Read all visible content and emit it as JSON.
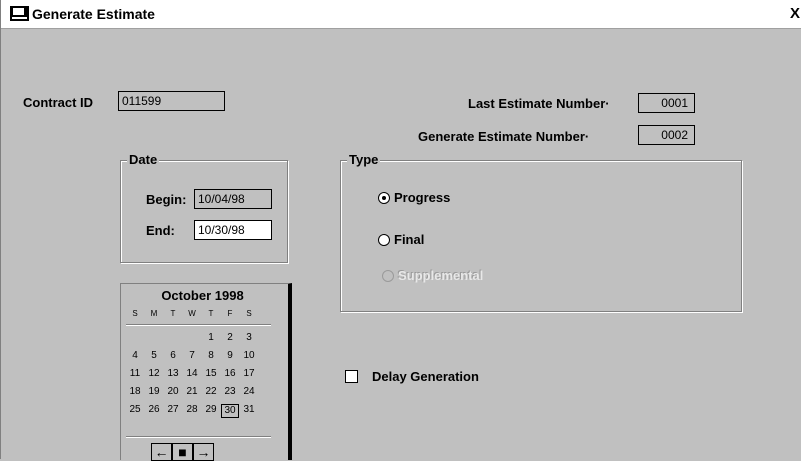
{
  "window": {
    "title": "Generate Estimate",
    "close_label": "X"
  },
  "contract": {
    "label": "Contract ID",
    "value": "011599"
  },
  "last_estimate": {
    "label": "Last Estimate Number·",
    "value": "0001"
  },
  "generate_estimate": {
    "label": "Generate Estimate Number·",
    "value": "0002"
  },
  "date_group": {
    "legend": "Date",
    "begin_label": "Begin:",
    "begin_value": "10/04/98",
    "end_label": "End:",
    "end_value": "10/30/98"
  },
  "type_group": {
    "legend": "Type",
    "options": [
      {
        "label": "Progress",
        "selected": true
      },
      {
        "label": "Final",
        "selected": false
      },
      {
        "label": "Supplemental",
        "selected": false,
        "disabled": true
      }
    ]
  },
  "delay": {
    "label": "Delay Generation",
    "checked": false
  },
  "calendar": {
    "month": "October 1998",
    "weekdays": [
      "S",
      "M",
      "T",
      "W",
      "T",
      "F",
      "S"
    ],
    "weeks": [
      [
        "",
        "",
        "",
        "",
        "1",
        "2",
        "3"
      ],
      [
        "4",
        "5",
        "6",
        "7",
        "8",
        "9",
        "10"
      ],
      [
        "11",
        "12",
        "13",
        "14",
        "15",
        "16",
        "17"
      ],
      [
        "18",
        "19",
        "20",
        "21",
        "22",
        "23",
        "24"
      ],
      [
        "25",
        "26",
        "27",
        "28",
        "29",
        "30",
        "31"
      ]
    ],
    "selected_day": "30",
    "nav": {
      "prev": "←",
      "today": "■",
      "next": "→"
    }
  }
}
